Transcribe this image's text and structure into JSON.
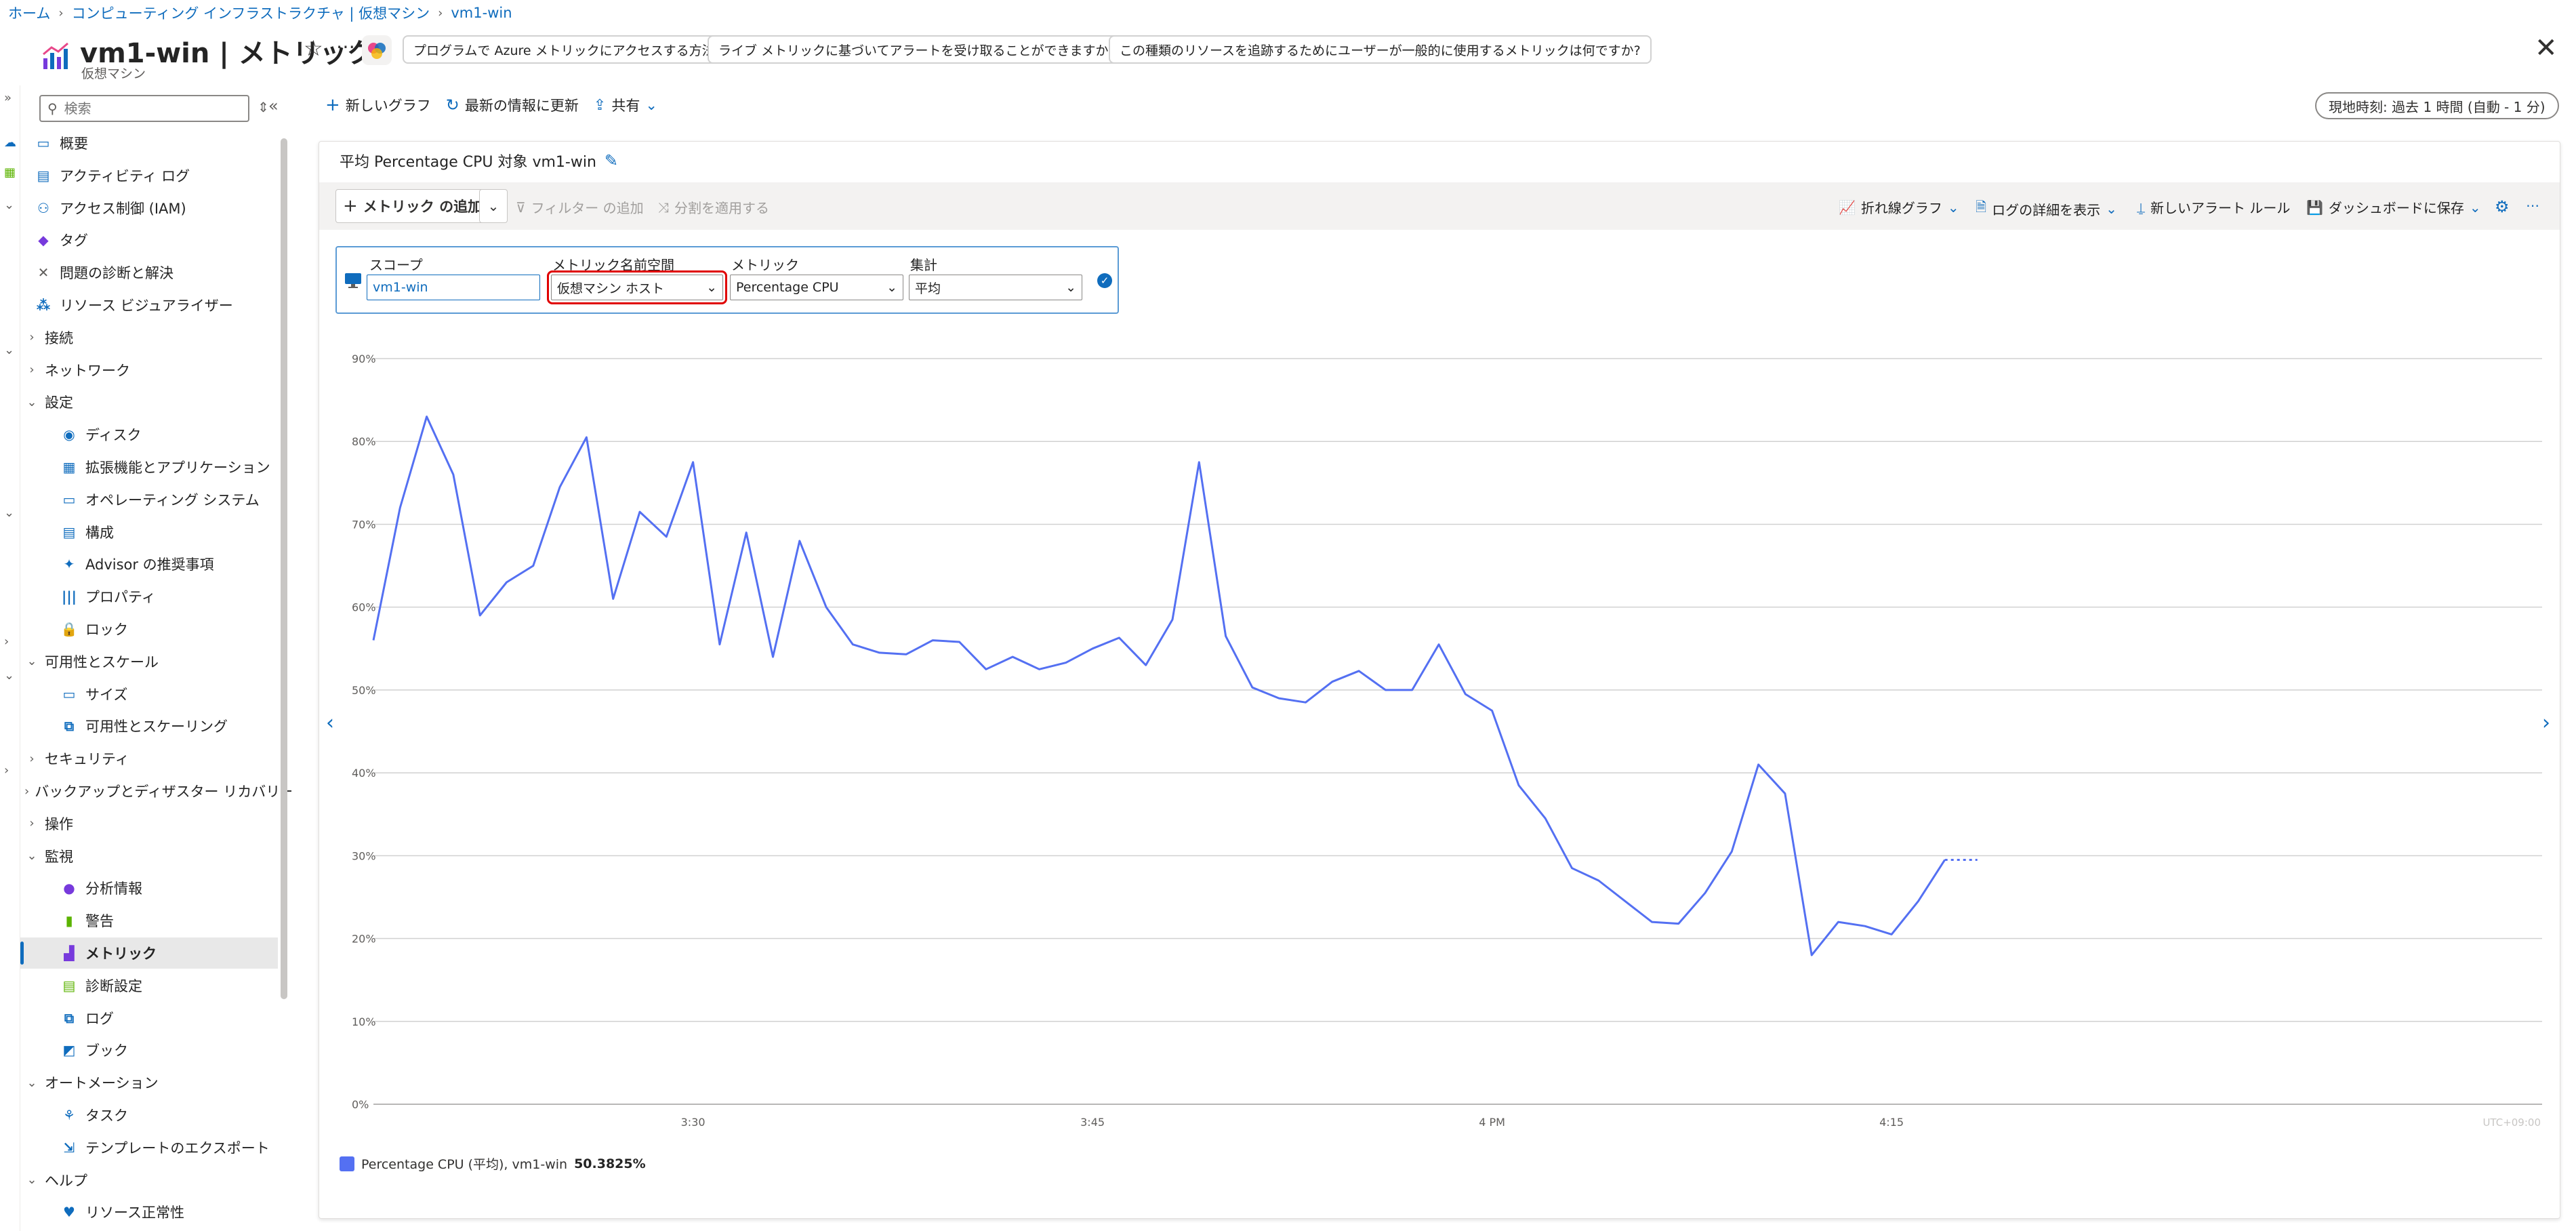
{
  "breadcrumb": [
    "ホーム",
    "コンピューティング インフラストラクチャ | 仮想マシン",
    "vm1-win"
  ],
  "header": {
    "title": "vm1-win | メトリック",
    "subtitle": "仮想マシン",
    "chips": [
      "プログラムで Azure メトリックにアクセスする方法",
      "ライブ メトリックに基づいてアラートを受け取ることができますか?",
      "この種類のリソースを追跡するためにユーザーが一般的に使用するメトリックは何ですか?"
    ]
  },
  "sidebar": {
    "search_placeholder": "検索",
    "items": [
      {
        "label": "概要",
        "icon": "monitor-icon",
        "indent": 0,
        "chev": ""
      },
      {
        "label": "アクティビティ ログ",
        "icon": "log-icon",
        "indent": 0,
        "chev": ""
      },
      {
        "label": "アクセス制御 (IAM)",
        "icon": "people-icon",
        "indent": 0,
        "chev": ""
      },
      {
        "label": "タグ",
        "icon": "tag-icon",
        "indent": 0,
        "chev": ""
      },
      {
        "label": "問題の診断と解決",
        "icon": "wrench-icon",
        "indent": 0,
        "chev": ""
      },
      {
        "label": "リソース ビジュアライザー",
        "icon": "visualizer-icon",
        "indent": 0,
        "chev": ""
      },
      {
        "label": "接続",
        "icon": "",
        "indent": 0,
        "chev": "›"
      },
      {
        "label": "ネットワーク",
        "icon": "",
        "indent": 0,
        "chev": "›"
      },
      {
        "label": "設定",
        "icon": "",
        "indent": 0,
        "chev": "⌄"
      },
      {
        "label": "ディスク",
        "icon": "disk-icon",
        "indent": 1,
        "chev": ""
      },
      {
        "label": "拡張機能とアプリケーション",
        "icon": "extension-icon",
        "indent": 1,
        "chev": ""
      },
      {
        "label": "オペレーティング システム",
        "icon": "os-icon",
        "indent": 1,
        "chev": ""
      },
      {
        "label": "構成",
        "icon": "config-icon",
        "indent": 1,
        "chev": ""
      },
      {
        "label": "Advisor の推奨事項",
        "icon": "advisor-icon",
        "indent": 1,
        "chev": ""
      },
      {
        "label": "プロパティ",
        "icon": "properties-icon",
        "indent": 1,
        "chev": ""
      },
      {
        "label": "ロック",
        "icon": "lock-icon",
        "indent": 1,
        "chev": ""
      },
      {
        "label": "可用性とスケール",
        "icon": "",
        "indent": 0,
        "chev": "⌄"
      },
      {
        "label": "サイズ",
        "icon": "size-icon",
        "indent": 1,
        "chev": ""
      },
      {
        "label": "可用性とスケーリング",
        "icon": "scaling-icon",
        "indent": 1,
        "chev": ""
      },
      {
        "label": "セキュリティ",
        "icon": "",
        "indent": 0,
        "chev": "›"
      },
      {
        "label": "バックアップとディザスター リカバリー",
        "icon": "",
        "indent": 0,
        "chev": "›"
      },
      {
        "label": "操作",
        "icon": "",
        "indent": 0,
        "chev": "›"
      },
      {
        "label": "監視",
        "icon": "",
        "indent": 0,
        "chev": "⌄"
      },
      {
        "label": "分析情報",
        "icon": "insights-icon",
        "indent": 1,
        "chev": ""
      },
      {
        "label": "警告",
        "icon": "alert-icon",
        "indent": 1,
        "chev": ""
      },
      {
        "label": "メトリック",
        "icon": "metrics-icon",
        "indent": 1,
        "chev": "",
        "active": true
      },
      {
        "label": "診断設定",
        "icon": "diagnostics-icon",
        "indent": 1,
        "chev": ""
      },
      {
        "label": "ログ",
        "icon": "logs-icon",
        "indent": 1,
        "chev": ""
      },
      {
        "label": "ブック",
        "icon": "workbook-icon",
        "indent": 1,
        "chev": ""
      },
      {
        "label": "オートメーション",
        "icon": "",
        "indent": 0,
        "chev": "⌄"
      },
      {
        "label": "タスク",
        "icon": "tasks-icon",
        "indent": 1,
        "chev": ""
      },
      {
        "label": "テンプレートのエクスポート",
        "icon": "export-icon",
        "indent": 1,
        "chev": ""
      },
      {
        "label": "ヘルプ",
        "icon": "",
        "indent": 0,
        "chev": "⌄"
      },
      {
        "label": "リソース正常性",
        "icon": "health-icon",
        "indent": 1,
        "chev": ""
      }
    ]
  },
  "toolbar": {
    "new_chart": "新しいグラフ",
    "refresh": "最新の情報に更新",
    "share": "共有",
    "time_range": "現地時刻: 過去 1 時間 (自動 - 1 分)"
  },
  "chart_card": {
    "title": "平均 Percentage CPU 対象 vm1-win",
    "add_metric": "メトリック の追加",
    "add_filter": "フィルター の追加",
    "apply_split": "分割を適用する",
    "line_chart": "折れ線グラフ",
    "logs_detail": "ログの詳細を表示",
    "new_alert": "新しいアラート ルール",
    "save_dashboard": "ダッシュボードに保存",
    "selector": {
      "scope_label": "スコープ",
      "scope_value": "vm1-win",
      "namespace_label": "メトリック名前空間",
      "namespace_value": "仮想マシン ホスト",
      "metric_label": "メトリック",
      "metric_value": "Percentage CPU",
      "aggregation_label": "集計",
      "aggregation_value": "平均"
    },
    "legend": {
      "label": "Percentage CPU (平均), vm1-win",
      "value": "50.3825%"
    }
  },
  "chart_data": {
    "type": "line",
    "title": "平均 Percentage CPU 対象 vm1-win",
    "ylim": [
      0,
      90
    ],
    "y_ticks": [
      "0%",
      "10%",
      "20%",
      "30%",
      "40%",
      "50%",
      "60%",
      "70%",
      "80%",
      "90%"
    ],
    "x_ticks": [
      {
        "label": "3:30",
        "minute": 12
      },
      {
        "label": "3:45",
        "minute": 27
      },
      {
        "label": "4 PM",
        "minute": 42
      },
      {
        "label": "4:15",
        "minute": 57
      }
    ],
    "timezone": "UTC+09:00",
    "grid": true,
    "series": [
      {
        "name": "Percentage CPU (平均), vm1-win",
        "color": "#5470f2",
        "values": [
          56,
          72,
          83,
          76,
          59,
          63,
          65,
          74.5,
          80.5,
          61,
          71.5,
          68.5,
          77.5,
          55.5,
          69,
          54,
          68,
          60,
          55.5,
          54.5,
          54.3,
          56,
          55.8,
          52.5,
          54,
          52.5,
          53.3,
          55,
          56.3,
          53,
          58.5,
          77.5,
          56.5,
          50.3,
          49,
          48.5,
          51,
          52.3,
          50,
          50,
          55.5,
          49.5,
          47.5,
          38.5,
          34.5,
          28.5,
          27,
          24.5,
          22,
          21.8,
          25.5,
          30.5,
          41,
          37.5,
          18,
          22,
          21.5,
          20.5,
          24.5,
          29.5
        ],
        "dotted_tail_end": 29.5
      }
    ]
  }
}
